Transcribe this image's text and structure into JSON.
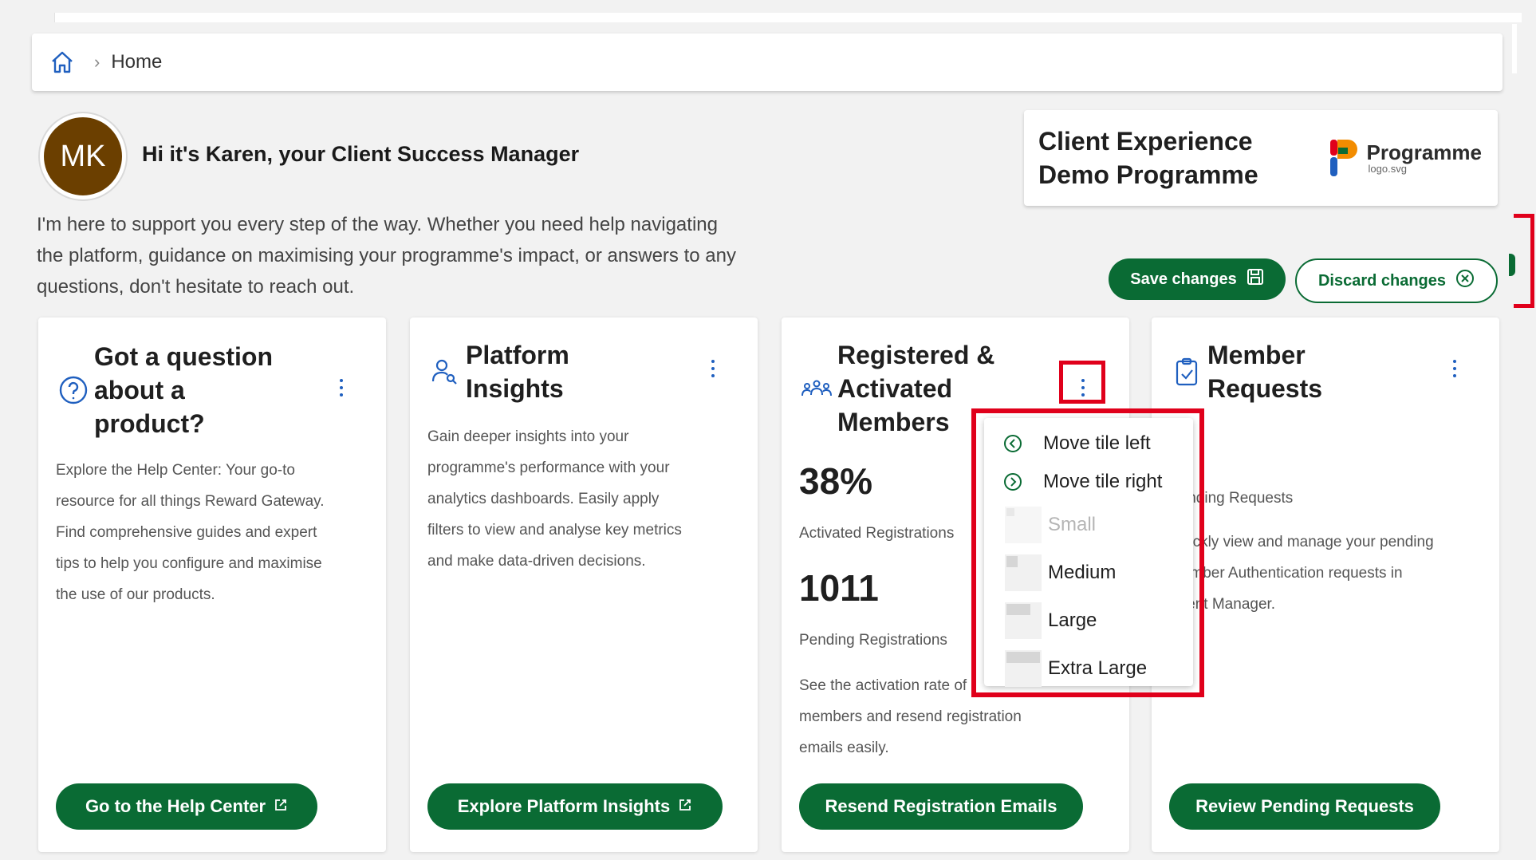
{
  "breadcrumb": {
    "items": [
      "Home"
    ]
  },
  "welcome": {
    "avatar_initials": "MK",
    "greeting": "Hi it's Karen, your Client Success Manager",
    "intro_lines": [
      "I'm here to support you every step of the way. Whether you need help navigating",
      "the platform, guidance on maximising your programme's impact, or answers to any",
      "questions, don't hesitate to reach out."
    ]
  },
  "client": {
    "name_lines": [
      "Client Experience",
      "Demo Programme"
    ],
    "logo_name": "Programme",
    "logo_sub": "logo.svg"
  },
  "actions": {
    "save_label": "Save changes",
    "discard_label": "Discard changes"
  },
  "cards": [
    {
      "title_lines": [
        "Got a question",
        "about a",
        "product?"
      ],
      "icon": "help-circle-icon",
      "description_lines": [
        "Explore the Help Center: Your go-to",
        "resource for all things Reward Gateway.",
        "Find comprehensive guides and expert",
        "tips to help you configure and maximise",
        "the use of our products."
      ],
      "button_label": "Go to the Help Center"
    },
    {
      "title_lines": [
        "Platform",
        "Insights"
      ],
      "icon": "user-insights-icon",
      "description_lines": [
        "Gain deeper insights into your",
        "programme's performance with your",
        "analytics dashboards. Easily apply",
        "filters to view and analyse key metrics",
        "and make data-driven decisions."
      ],
      "button_label": "Explore Platform Insights"
    },
    {
      "title_lines": [
        "Registered &",
        "Activated",
        "Members"
      ],
      "icon": "group-icon",
      "stat1_value": "38%",
      "stat1_label": "Activated Registrations",
      "stat2_value": "1011",
      "stat2_label": "Pending Registrations",
      "description_lines": [
        "See the activation rate of",
        "members and resend registration",
        "emails easily."
      ],
      "button_label": "Resend Registration Emails"
    },
    {
      "title_lines": [
        "Member",
        "Requests"
      ],
      "icon": "clipboard-check-icon",
      "stat_label": "Pending Requests",
      "description_lines": [
        "Quickly view and manage your pending",
        "Member Authentication requests in",
        "Client Manager."
      ],
      "button_label": "Review Pending Requests"
    }
  ],
  "tile_menu": {
    "items": [
      {
        "label": "Move tile left",
        "icon": "chevron-left-circle-icon"
      },
      {
        "label": "Move tile right",
        "icon": "chevron-right-circle-icon"
      }
    ],
    "sizes": [
      {
        "label": "Small",
        "disabled": true
      },
      {
        "label": "Medium",
        "disabled": false
      },
      {
        "label": "Large",
        "disabled": false
      },
      {
        "label": "Extra Large",
        "disabled": false
      }
    ]
  },
  "colors": {
    "brand_green": "#0a6b34",
    "highlight_red": "#e0001b",
    "icon_blue": "#1f5fbf",
    "avatar_brown": "#6b3f00"
  }
}
